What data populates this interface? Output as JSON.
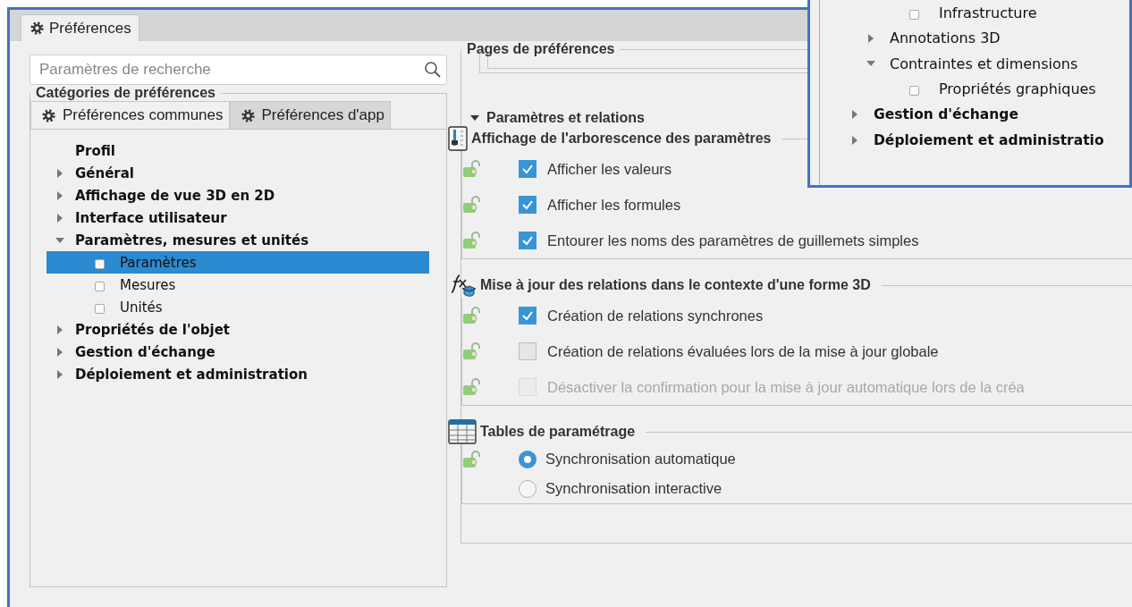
{
  "tab": {
    "label": "Préférences",
    "selected": true
  },
  "search": {
    "placeholder": "Paramètres de recherche"
  },
  "categories": {
    "title": "Catégories de préférences",
    "tabs": [
      {
        "label": "Préférences communes",
        "selected": true
      },
      {
        "label": "Préférences d'app",
        "selected": false
      }
    ],
    "tree": [
      {
        "label": "Profil",
        "selected": false
      },
      {
        "label": "Général",
        "expanded": false,
        "selected": false
      },
      {
        "label": "Affichage de vue 3D en 2D",
        "expanded": false,
        "selected": false
      },
      {
        "label": "Interface utilisateur",
        "expanded": false,
        "selected": false
      },
      {
        "label": "Paramètres, mesures et unités",
        "expanded": true,
        "selected": false,
        "children": [
          {
            "label": "Paramètres",
            "selected": true
          },
          {
            "label": "Mesures",
            "selected": false
          },
          {
            "label": "Unités",
            "selected": false
          }
        ]
      },
      {
        "label": "Propriétés de l'objet",
        "expanded": false,
        "selected": false
      },
      {
        "label": "Gestion d'échange",
        "expanded": false,
        "selected": false
      },
      {
        "label": "Déploiement et administration",
        "expanded": false,
        "selected": false
      }
    ]
  },
  "pages": {
    "title": "Pages de préférences",
    "section": {
      "label": "Paramètres et relations",
      "expanded": true,
      "groups": [
        {
          "title": "Affichage de l'arborescence des paramètres",
          "rows": [
            {
              "kind": "checkbox",
              "label": "Afficher les valeurs",
              "checked": true,
              "disabled": false,
              "lock_icon": true
            },
            {
              "kind": "checkbox",
              "label": "Afficher les formules",
              "checked": true,
              "disabled": false,
              "lock_icon": true
            },
            {
              "kind": "checkbox",
              "label": "Entourer les noms des paramètres de guillemets simples",
              "checked": true,
              "disabled": false,
              "lock_icon": true
            }
          ]
        },
        {
          "title": "Mise à jour des relations dans le contexte d'une forme 3D",
          "rows": [
            {
              "kind": "checkbox",
              "label": "Création de relations synchrones",
              "checked": true,
              "disabled": false,
              "lock_icon": true
            },
            {
              "kind": "checkbox",
              "label": "Création de relations évaluées lors de la mise à jour globale",
              "checked": false,
              "disabled": false,
              "lock_icon": true
            },
            {
              "kind": "checkbox",
              "label": "Désactiver la confirmation pour la mise à jour automatique lors de la créa",
              "checked": false,
              "disabled": true,
              "lock_icon": true
            }
          ]
        },
        {
          "title": "Tables de paramétrage",
          "rows": [
            {
              "kind": "radio",
              "label": "Synchronisation automatique",
              "selected": true,
              "disabled": false,
              "lock_icon": true
            },
            {
              "kind": "radio",
              "label": "Synchronisation interactive",
              "selected": false,
              "disabled": false,
              "lock_icon": false
            }
          ]
        }
      ]
    }
  },
  "overlay": {
    "tree": [
      {
        "children": [
          {
            "children": [
              {
                "label": "Infrastructure",
                "selected": false
              }
            ]
          },
          {
            "label": "Annotations 3D",
            "expanded": false,
            "selected": false
          },
          {
            "label": "Contraintes et dimensions",
            "expanded": true,
            "selected": false,
            "children": [
              {
                "label": "Propriétés graphiques",
                "selected": false
              }
            ]
          }
        ]
      },
      {
        "label": "Gestion d'échange",
        "expanded": false,
        "selected": false
      },
      {
        "label": "Déploiement et administratio",
        "expanded": false,
        "selected": false
      }
    ]
  }
}
